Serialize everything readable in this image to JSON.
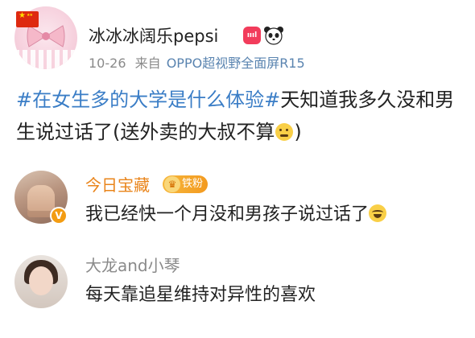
{
  "post": {
    "username": "冰冰冰阔乐pepsi",
    "vip_badge": "ıııl",
    "time": "10-26",
    "source_prefix": "来自",
    "source": "OPPO超视野全面屏R15",
    "topic": "#在女生多的大学是什么体验#",
    "text_1": "天知道我多久没和男生说过话了(送外卖的大叔不算",
    "text_2": ")",
    "flag_icon": "china-flag-icon",
    "extra_icon": "panda-icon"
  },
  "comments": [
    {
      "name": "今日宝藏",
      "badge": "铁粉",
      "text": "我已经快一个月没和男孩子说过话了",
      "emoji": "laugh-cry-emoji",
      "name_color": "#e9841a"
    },
    {
      "name": "大龙and小琴",
      "text": "每天靠追星维持对异性的喜欢",
      "name_color": "#8a8a8a"
    }
  ],
  "colors": {
    "topic": "#3a7dc6",
    "source": "#5a84b0",
    "vip": "#f23c5b"
  }
}
